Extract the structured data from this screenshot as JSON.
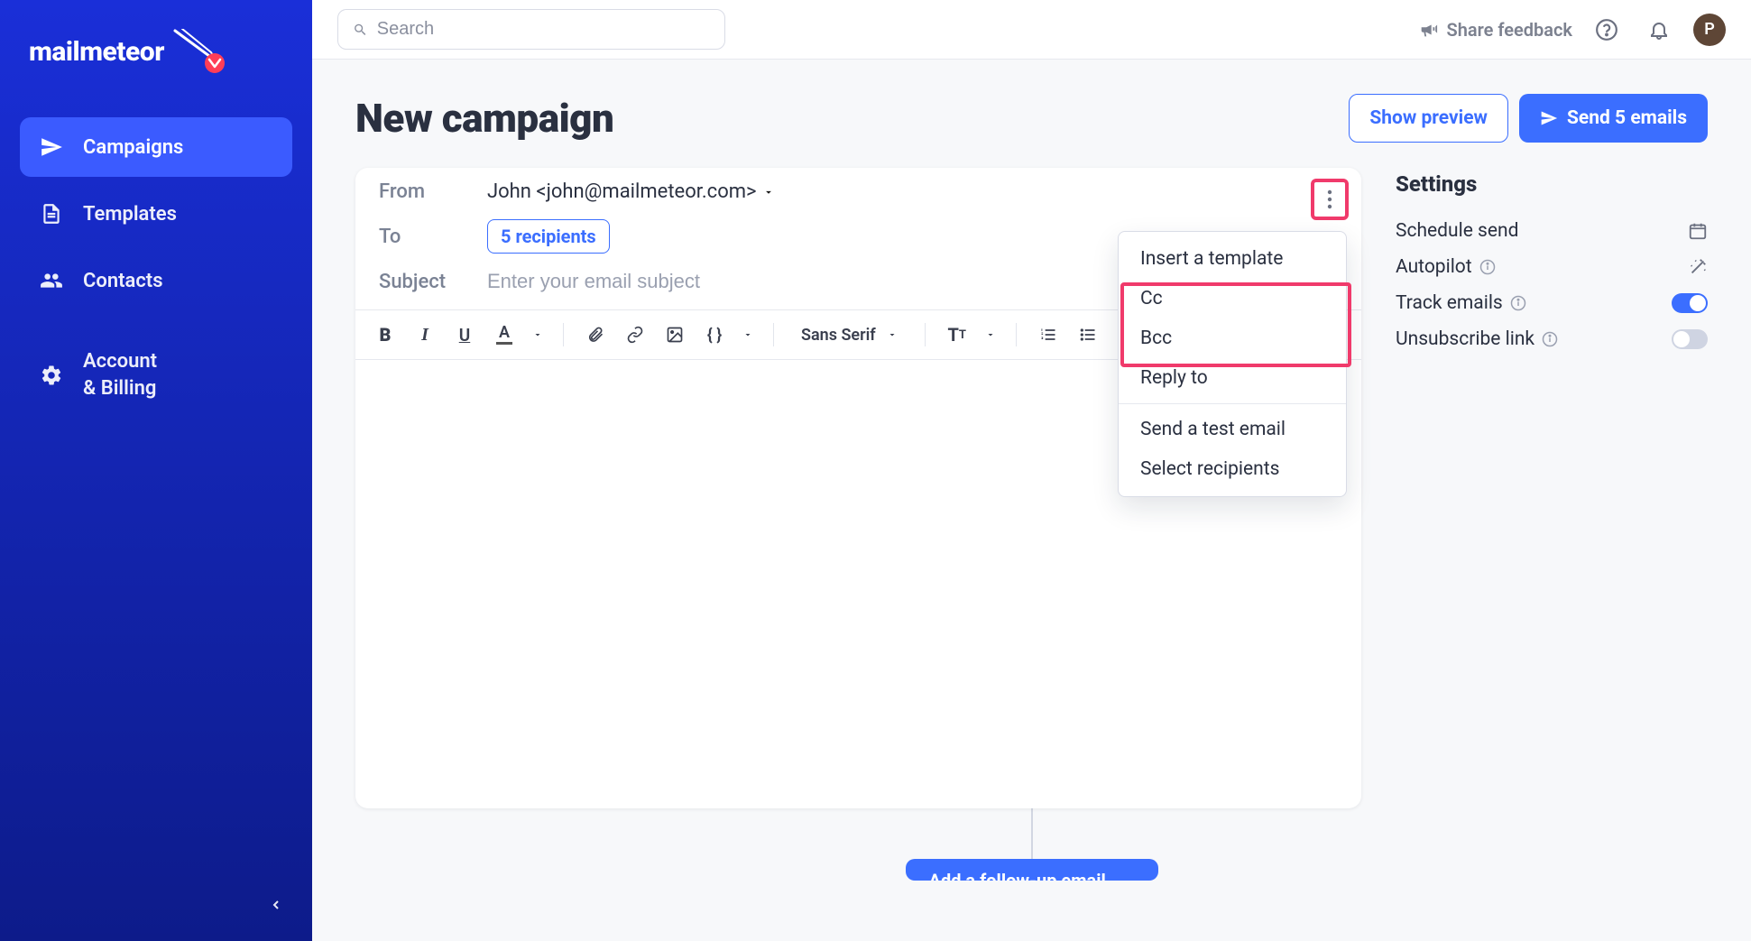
{
  "brand": {
    "name": "mailmeteor"
  },
  "sidebar": {
    "items": [
      {
        "label": "Campaigns"
      },
      {
        "label": "Templates"
      },
      {
        "label": "Contacts"
      },
      {
        "label": "Account\n& Billing"
      }
    ]
  },
  "topbar": {
    "search_placeholder": "Search",
    "feedback_label": "Share feedback",
    "avatar_letter": "P"
  },
  "page": {
    "title": "New campaign",
    "preview_label": "Show preview",
    "send_label": "Send 5 emails"
  },
  "composer": {
    "from_label": "From",
    "from_value": "John <john@mailmeteor.com>",
    "to_label": "To",
    "to_chip": "5 recipients",
    "subject_label": "Subject",
    "subject_placeholder": "Enter your email subject",
    "font_label": "Sans Serif"
  },
  "dropdown": {
    "items": [
      "Insert a template",
      "Cc",
      "Bcc",
      "Reply to",
      "Send a test email",
      "Select recipients"
    ]
  },
  "settings": {
    "title": "Settings",
    "rows": [
      {
        "label": "Schedule send"
      },
      {
        "label": "Autopilot"
      },
      {
        "label": "Track emails"
      },
      {
        "label": "Unsubscribe link"
      }
    ]
  },
  "followup": {
    "label": "Add a follow-up email"
  }
}
